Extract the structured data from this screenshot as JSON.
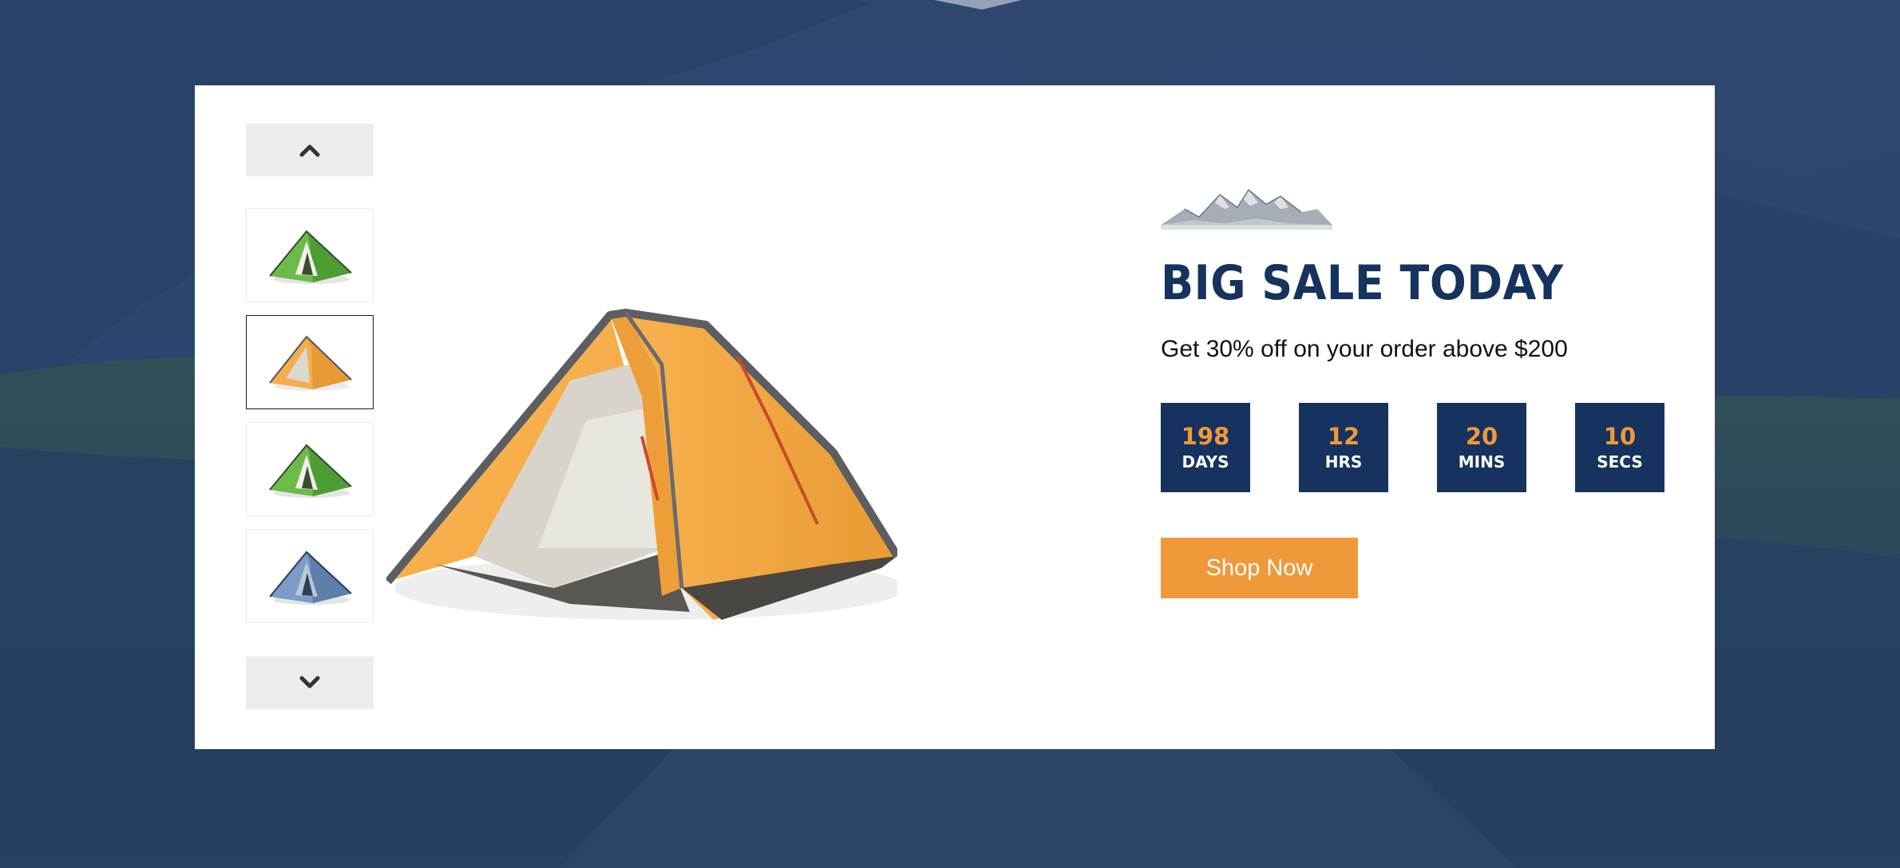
{
  "promo": {
    "headline": "BIG SALE TODAY",
    "subtext": "Get 30% off on your order above $200",
    "cta_label": "Shop Now"
  },
  "countdown": [
    {
      "value": "198",
      "unit": "DAYS"
    },
    {
      "value": "12",
      "unit": "HRS"
    },
    {
      "value": "20",
      "unit": "MINS"
    },
    {
      "value": "10",
      "unit": "SECS"
    }
  ],
  "gallery": {
    "thumbnails": [
      {
        "product": "green-tent",
        "selected": false
      },
      {
        "product": "orange-tent",
        "selected": true
      },
      {
        "product": "green-tent",
        "selected": false
      },
      {
        "product": "blue-tent",
        "selected": false
      }
    ],
    "up_icon": "chevron-up-icon",
    "down_icon": "chevron-down-icon"
  },
  "colors": {
    "brand_navy": "#16325e",
    "accent_orange": "#f0993a",
    "panel_white": "#ffffff",
    "nav_gray": "#ececec"
  }
}
